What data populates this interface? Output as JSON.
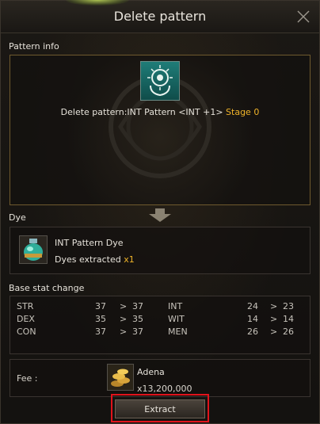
{
  "window": {
    "title": "Delete pattern"
  },
  "pattern_info": {
    "section_label": "Pattern info",
    "delete_text": "Delete pattern:INT Pattern <INT +1>",
    "stage_text": "Stage 0"
  },
  "dye": {
    "section_label": "Dye",
    "name": "INT Pattern Dye",
    "extracted_label": "Dyes extracted",
    "extracted_count": "x1"
  },
  "base_stat": {
    "section_label": "Base stat change",
    "arrow": ">",
    "rows": [
      {
        "left": {
          "stat": "STR",
          "before": "37",
          "after": "37"
        },
        "right": {
          "stat": "INT",
          "before": "24",
          "after": "23"
        }
      },
      {
        "left": {
          "stat": "DEX",
          "before": "35",
          "after": "35"
        },
        "right": {
          "stat": "WIT",
          "before": "14",
          "after": "14"
        }
      },
      {
        "left": {
          "stat": "CON",
          "before": "37",
          "after": "37"
        },
        "right": {
          "stat": "MEN",
          "before": "26",
          "after": "26"
        }
      }
    ]
  },
  "fee": {
    "label": "Fee :",
    "item_name": "Adena",
    "amount": "x13,200,000"
  },
  "actions": {
    "extract_label": "Extract"
  },
  "icons": {
    "close": "close-icon",
    "pattern": "pattern-emblem-icon",
    "arrow": "arrow-down-icon",
    "dye": "dye-potion-icon",
    "adena": "adena-coins-icon"
  },
  "colors": {
    "accent_gold": "#f0b42a",
    "highlight_red": "#e0131b",
    "frame_gold": "#6f5a2e"
  }
}
